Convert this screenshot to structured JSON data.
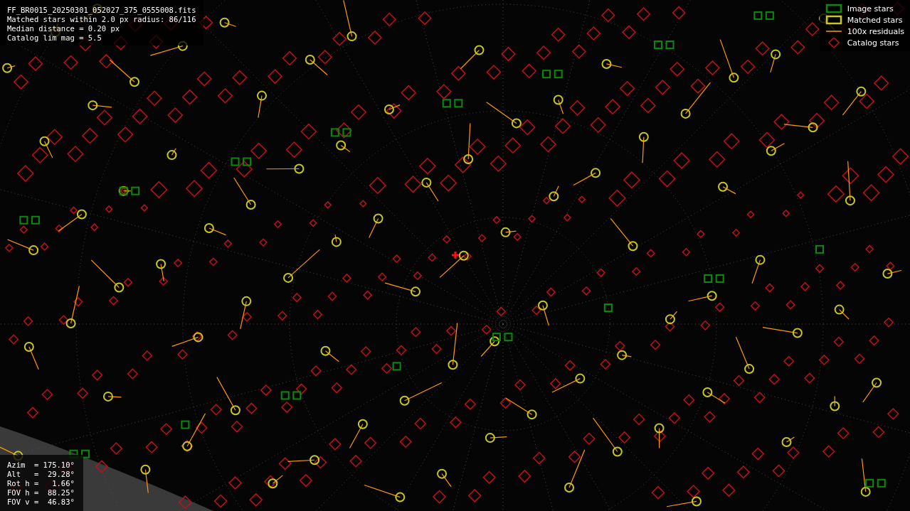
{
  "info_lines": [
    "FF_BR0015_20250301_052027_375_0555008.fits",
    "Matched stars within 2.0 px radius: 86/116",
    "Median distance = 0.20 px",
    "Catalog lim mag = 5.5"
  ],
  "legend": [
    {
      "kind": "image",
      "label": "Image stars"
    },
    {
      "kind": "matched",
      "label": "Matched stars"
    },
    {
      "kind": "residual",
      "label": "100x residuals"
    },
    {
      "kind": "catalog",
      "label": "Catalog stars"
    }
  ],
  "pointing": [
    "Azim  = 175.10°",
    "Alt   =  29.28°",
    "Rot h =   1.66°",
    "FOV h =  88.25°",
    "FOV v =  46.83°"
  ]
}
